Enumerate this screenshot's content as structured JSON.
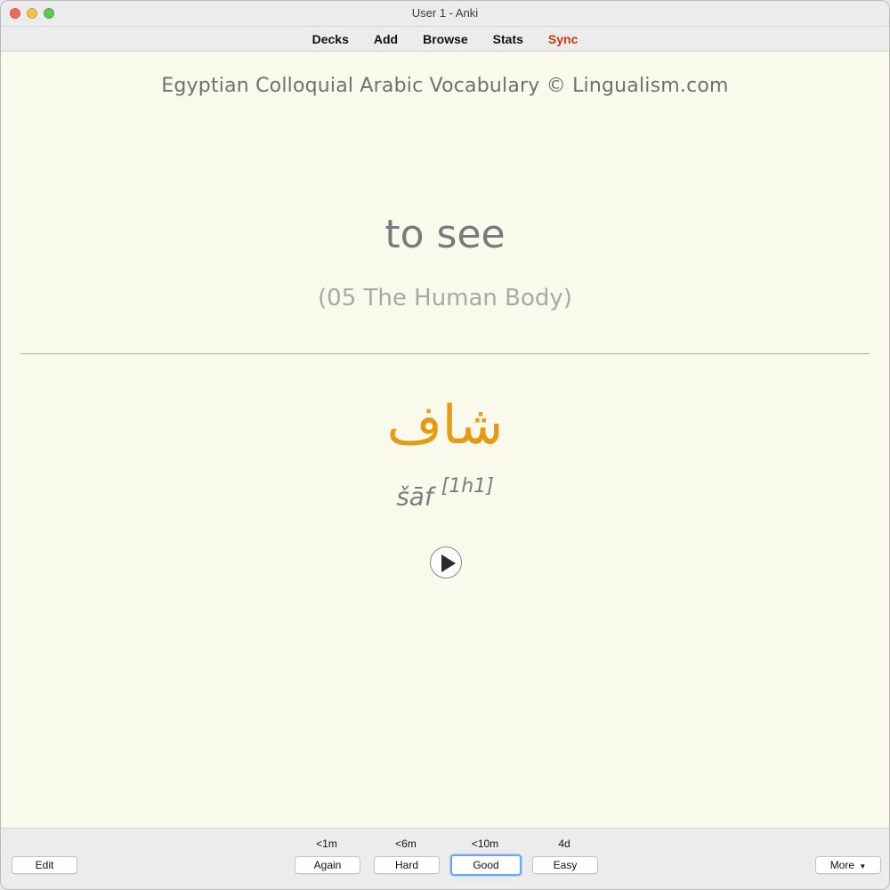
{
  "window": {
    "title": "User 1 - Anki"
  },
  "toolbar": {
    "items": [
      {
        "label": "Decks"
      },
      {
        "label": "Add"
      },
      {
        "label": "Browse"
      },
      {
        "label": "Stats"
      },
      {
        "label": "Sync"
      }
    ],
    "sync_color": "#c83a0c"
  },
  "card": {
    "deck_title": "Egyptian Colloquial Arabic Vocabulary © Lingualism.com",
    "front": "to see",
    "category": "(05 The Human Body)",
    "arabic": "شاف",
    "arabic_color": "#e89a10",
    "transliteration": "šāf",
    "verb_class": "[1h1]",
    "audio_icon": "play-icon",
    "background_color": "#f9f9ec"
  },
  "bottom": {
    "edit_label": "Edit",
    "more_label": "More",
    "more_icon": "caret-down-icon",
    "answers": [
      {
        "interval": "<1m",
        "label": "Again"
      },
      {
        "interval": "<6m",
        "label": "Hard"
      },
      {
        "interval": "<10m",
        "label": "Good",
        "focused": true
      },
      {
        "interval": "4d",
        "label": "Easy"
      }
    ],
    "focus_color": "#6aa6f6"
  }
}
